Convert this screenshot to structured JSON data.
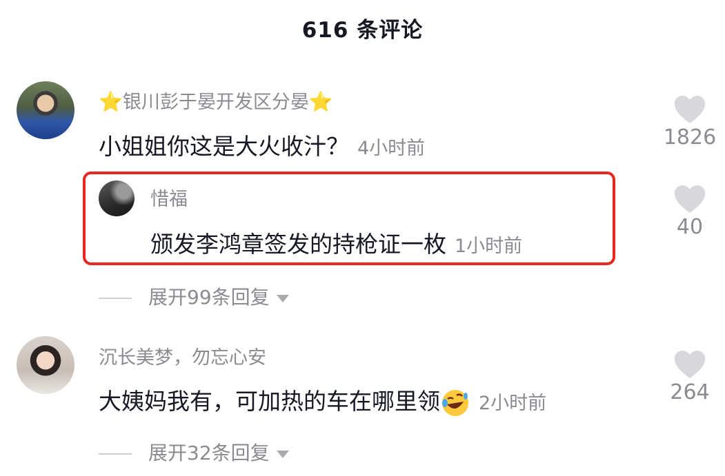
{
  "header": {
    "title": "616 条评论"
  },
  "comments": [
    {
      "name_prefix": "⭐",
      "name": "银川彭于晏开发区分晏",
      "name_suffix": "⭐",
      "text": "小姐姐你这是大火收汁？",
      "time": "4小时前",
      "likes": "1826",
      "reply": {
        "name": "惜福",
        "text": "颁发李鸿章签发的持枪证一枚",
        "time": "1小时前",
        "likes": "40"
      },
      "expand_label": "展开99条回复"
    },
    {
      "name": "沉长美梦，勿忘心安",
      "text": "大姨妈我有，可加热的车在哪里领",
      "emoji": "rolling-laughing-emoji",
      "time": "2小时前",
      "likes": "264",
      "expand_label": "展开32条回复"
    }
  ],
  "colors": {
    "highlight_border": "#e8281f",
    "secondary_text": "#8a8b91",
    "heart": "#d8d8dc"
  },
  "icons": {
    "like": "heart-icon",
    "expand": "triangle-down-icon"
  }
}
